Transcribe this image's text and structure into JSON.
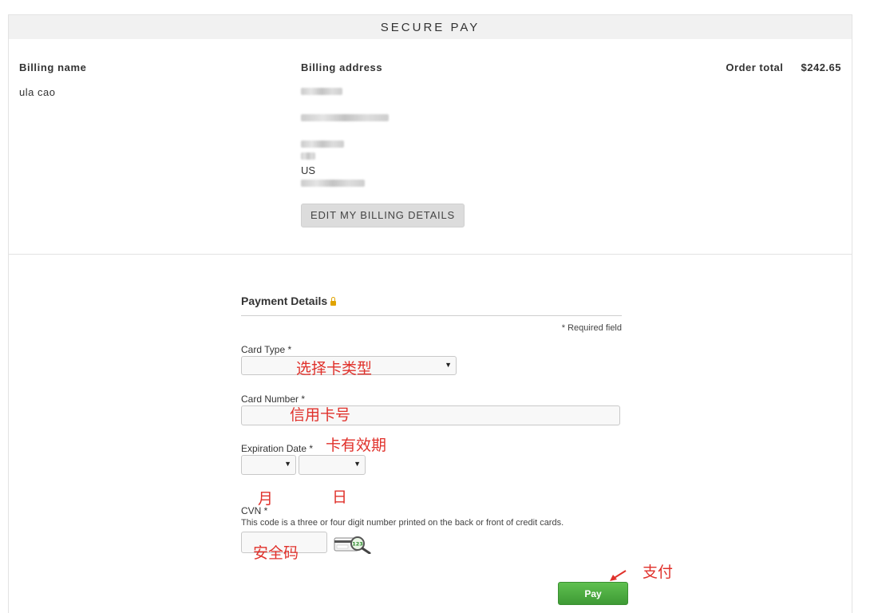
{
  "header": {
    "title": "SECURE PAY"
  },
  "billing": {
    "name_label": "Billing name",
    "name_value": "ula cao",
    "address_label": "Billing address",
    "address_country": "US",
    "edit_button_label": "EDIT MY BILLING DETAILS",
    "order_total_label": "Order total",
    "order_total_value": "$242.65"
  },
  "payment": {
    "title": "Payment Details",
    "required_note": "* Required field",
    "card_type_label": "Card Type *",
    "card_number_label": "Card Number *",
    "expiration_label": "Expiration Date *",
    "cvn_label": "CVN *",
    "cvn_help": "This code is a three or four digit number printed on the back or front of credit cards.",
    "pay_button_label": "Pay"
  },
  "annotations": {
    "card_type": "选择卡类型",
    "card_number": "信用卡号",
    "expiration": "卡有效期",
    "month": "月",
    "day": "日",
    "cvn": "安全码",
    "pay": "支付",
    "color": "#e0312b"
  },
  "icons": {
    "lock": "lock-icon",
    "card_cvn": "card-cvn-icon",
    "dropdown": "chevron-down-icon"
  },
  "colors": {
    "pay_button": "#46a83c",
    "header_bg": "#f1f1f1",
    "lock": "#e0a300"
  }
}
